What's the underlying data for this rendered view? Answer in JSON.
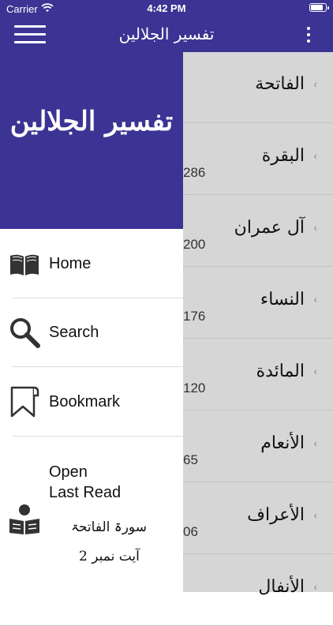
{
  "status_bar": {
    "carrier": "Carrier",
    "time": "4:42 PM",
    "battery_level": 0.85,
    "wifi_icon": "wifi-icon"
  },
  "nav_bar": {
    "title": "تفسیر الجلالین",
    "menu_icon": "hamburger-menu-icon",
    "more_icon": "more-vertical-icon",
    "background_color": "#3b3494"
  },
  "drawer": {
    "header_title": "تفسیر الجلالین",
    "items": [
      {
        "label": "Home",
        "icon": "book-open-icon"
      },
      {
        "label": "Search",
        "icon": "magnifier-icon"
      },
      {
        "label": "Bookmark",
        "icon": "bookmark-icon"
      }
    ],
    "last_read": {
      "label_line1": "Open",
      "label_line2": "Last Read",
      "icon": "reader-icon",
      "surah": "سورۃ الفاتحۃ",
      "ayah": "آیت نمبر 2"
    }
  },
  "surah_list": [
    {
      "name": "الفاتحة",
      "count": ""
    },
    {
      "name": "البقرة",
      "count": "286"
    },
    {
      "name": "آل عمران",
      "count": "200"
    },
    {
      "name": "النساء",
      "count": "176"
    },
    {
      "name": "المائدة",
      "count": "120"
    },
    {
      "name": "الأنعام",
      "count": "65"
    },
    {
      "name": "الأعراف",
      "count": "06"
    },
    {
      "name": "الأنفال",
      "count": ""
    }
  ],
  "chevron_icon": "chevron-left-icon"
}
